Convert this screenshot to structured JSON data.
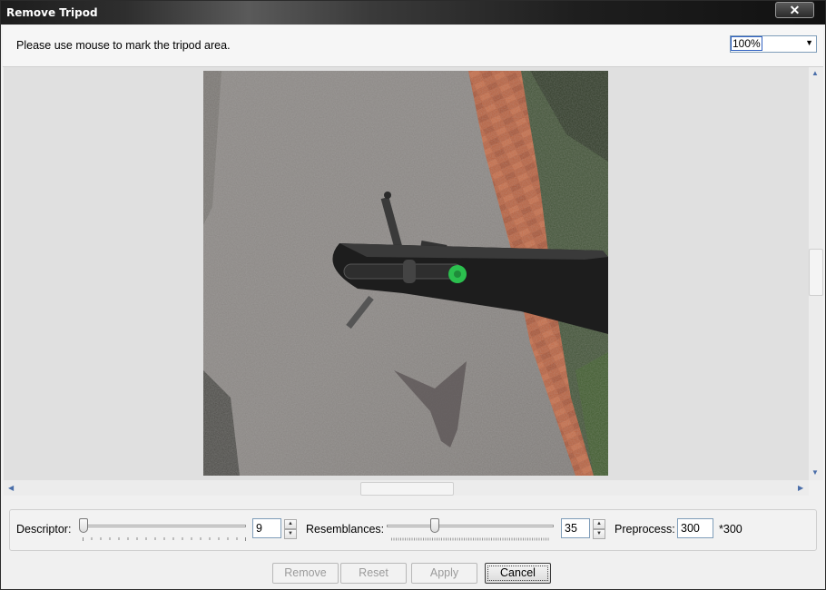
{
  "window": {
    "title": "Remove Tripod",
    "close_glyph": "✕"
  },
  "instruction": "Please use mouse to mark the tripod area.",
  "zoom": {
    "value": "100%"
  },
  "controls": {
    "descriptor": {
      "label": "Descriptor:",
      "value": "9"
    },
    "resemblances": {
      "label": "Resemblances:",
      "value": "35"
    },
    "preprocess": {
      "label": "Preprocess:",
      "value": "300",
      "suffix": "*300"
    }
  },
  "buttons": {
    "remove": "Remove",
    "reset": "Reset",
    "apply": "Apply",
    "cancel": "Cancel"
  },
  "icons": {
    "close": "close-icon",
    "dropdown": "chevron-down-icon",
    "spin": "spin-arrows-icon"
  }
}
